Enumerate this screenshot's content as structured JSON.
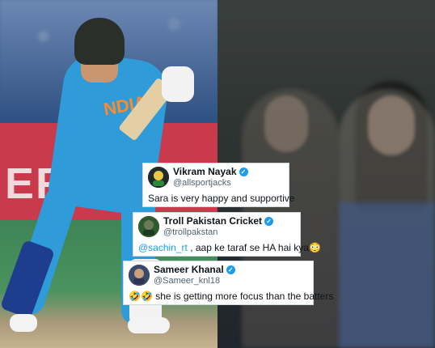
{
  "left_photo": {
    "board_text": "ER",
    "jersey_text": "NDIA"
  },
  "tweets": [
    {
      "name": "Vikram Nayak",
      "handle": "@allsportjacks",
      "text": "Sara is very happy and supportive",
      "avatar_color": "#1f2a2a"
    },
    {
      "name": "Troll Pakistan Cricket",
      "handle": "@trollpakstan",
      "mention": "@sachin_rt",
      "text": " , aap ke taraf se HA hai kya",
      "emoji": "😳",
      "avatar_color": "#2d5a2a"
    },
    {
      "name": "Sameer Khanal",
      "handle": "@Sameer_knl18",
      "emoji": "🤣🤣",
      "text": " she is getting more focus than the batters",
      "avatar_color": "#3a4a6a"
    }
  ],
  "colors": {
    "verified": "#1d9bf0",
    "mention": "#1d9bf0",
    "handle": "#536471"
  },
  "icons": {
    "verified": "verified-badge-icon"
  }
}
